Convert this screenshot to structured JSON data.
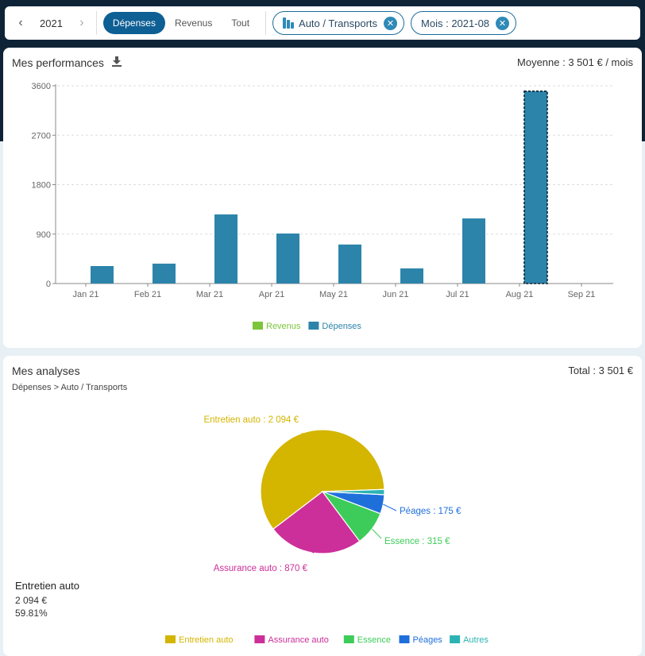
{
  "toolbar": {
    "year": "2021",
    "prev_icon": "chevron-left-icon",
    "next_icon": "chevron-right-icon",
    "segments": [
      {
        "label": "Dépenses",
        "active": true
      },
      {
        "label": "Revenus",
        "active": false
      },
      {
        "label": "Tout",
        "active": false
      }
    ],
    "filters": [
      {
        "label": "Auto / Transports",
        "icon": "bar-chart-icon"
      },
      {
        "label": "Mois : 2021-08",
        "icon": null
      }
    ]
  },
  "performance": {
    "title": "Mes performances",
    "download_icon": "download-icon",
    "average": "Moyenne : 3 501 € / mois"
  },
  "analyses": {
    "title": "Mes analyses",
    "breadcrumb": "Dépenses > Auto / Transports",
    "total": "Total : 3 501 €",
    "selected": {
      "label": "Entretien auto",
      "amount": "2 094 €",
      "percent": "59.81%"
    }
  },
  "colors": {
    "depenses": "#2c84ab",
    "revenus": "#7cc43a",
    "primary": "#0e5f94"
  },
  "chart_data": [
    {
      "type": "bar",
      "title": "Mes performances",
      "categories": [
        "Jan 21",
        "Feb 21",
        "Mar 21",
        "Apr 21",
        "May 21",
        "Jun 21",
        "Jul 21",
        "Aug 21",
        "Sep 21"
      ],
      "series": [
        {
          "name": "Revenus",
          "color": "#7cc43a",
          "values": [
            0,
            0,
            0,
            0,
            0,
            0,
            0,
            0,
            0
          ]
        },
        {
          "name": "Dépenses",
          "color": "#2c84ab",
          "values": [
            318,
            362,
            1258,
            910,
            710,
            275,
            1185,
            3501,
            0
          ]
        }
      ],
      "highlighted_category": "Aug 21",
      "yticks": [
        0,
        900,
        1800,
        2700,
        3600
      ],
      "ylim": [
        0,
        3600
      ],
      "grid": true,
      "legend": "bottom-center",
      "xlabel": "",
      "ylabel": ""
    },
    {
      "type": "pie",
      "title": "Mes analyses",
      "slices": [
        {
          "label": "Entretien auto",
          "value": 2094,
          "display": "Entretien auto : 2 094 €",
          "color": "#d4b500"
        },
        {
          "label": "Assurance auto",
          "value": 870,
          "display": "Assurance auto : 870 €",
          "color": "#cc2f99"
        },
        {
          "label": "Essence",
          "value": 315,
          "display": "Essence : 315 €",
          "color": "#3dcc5a"
        },
        {
          "label": "Péages",
          "value": 175,
          "display": "Péages : 175 €",
          "color": "#1f6fdb"
        },
        {
          "label": "Autres",
          "value": 47,
          "display": "",
          "color": "#2bb3b3"
        }
      ],
      "legend": "bottom-center"
    }
  ]
}
